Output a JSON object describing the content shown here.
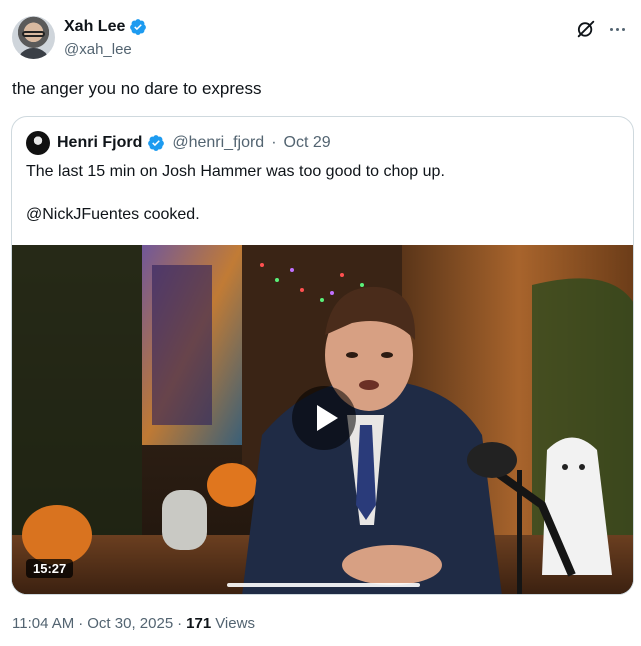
{
  "author": {
    "name": "Xah Lee",
    "handle": "@xah_lee"
  },
  "tweet": {
    "text": "the anger you no dare to express"
  },
  "quoted": {
    "name": "Henri Fjord",
    "handle": "@henri_fjord",
    "separator": "·",
    "date": "Oct 29",
    "line1": "The last 15 min on Josh Hammer was too good to chop up.",
    "line2": "@NickJFuentes cooked.",
    "video": {
      "duration": "15:27"
    }
  },
  "footer": {
    "time": "11:04 AM",
    "separator1": "·",
    "date": "Oct 30, 2025",
    "separator2": "·",
    "views_count": "171",
    "views_label": "Views"
  },
  "colors": {
    "verified": "#1d9bf0",
    "secondary_text": "#536471",
    "border": "#cfd9de"
  },
  "icons": [
    "verified-badge-icon",
    "grok-icon",
    "more-icon",
    "play-icon"
  ]
}
